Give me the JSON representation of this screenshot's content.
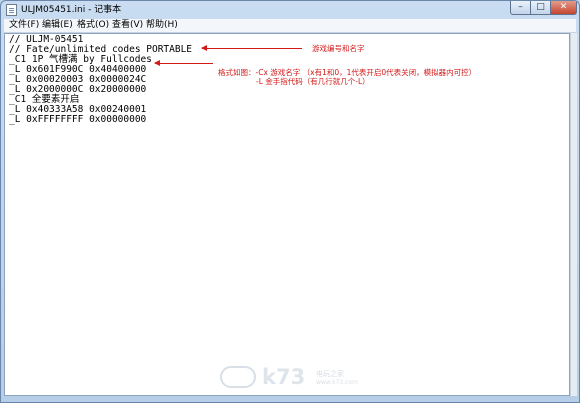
{
  "window": {
    "title": "ULJM05451.ini - 记事本"
  },
  "controls": {
    "minimize": "–",
    "maximize": "□",
    "close": "✕"
  },
  "menu": [
    {
      "label": "文件(F)"
    },
    {
      "label": "编辑(E)"
    },
    {
      "label": "格式(O)"
    },
    {
      "label": "查看(V)"
    },
    {
      "label": "帮助(H)"
    }
  ],
  "editor": {
    "content": "// ULJM-05451\n// Fate/unlimited codes PORTABLE\n_C1 1P 气槽满 by Fullcodes\n_L 0x601F990C 0x40400000\n_L 0x00020003 0x0000024C\n_L 0x2000000C 0x20000000\n_C1 全要素开启\n_L 0x40333A58 0x00240001\n_L 0xFFFFFFFF 0x00000000"
  },
  "annotations": {
    "game_label": "游戏编号和名字",
    "format_line1": "格式如图：-Cx  游戏名字   （x有1和0，1代表开启0代表关闭，模拟器内可控）",
    "format_line2": "-L  金手指代码（有几行就几个-L）"
  },
  "watermark": {
    "brand": "k73",
    "sub": "电玩之家",
    "url": "www.k73.com"
  },
  "colors": {
    "annotation": "#d31818",
    "titlebar": "#c9dcf1"
  }
}
